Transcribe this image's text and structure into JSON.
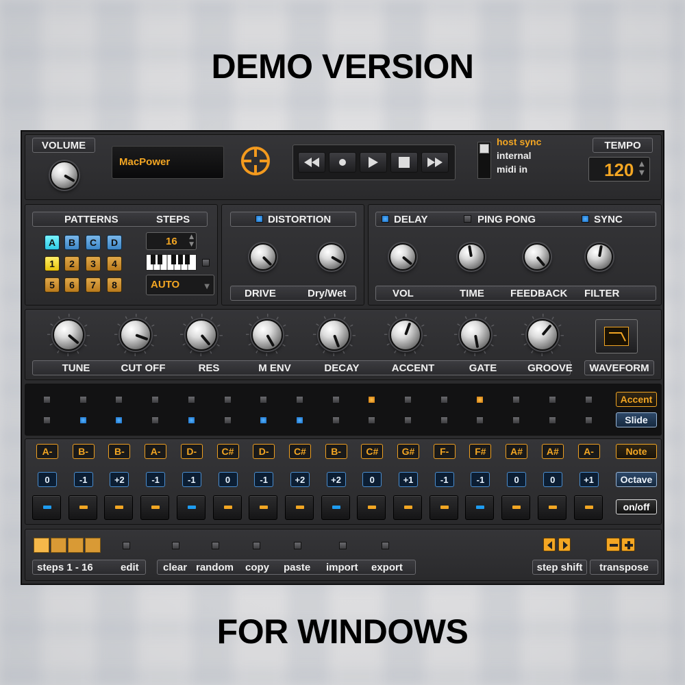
{
  "banner": {
    "top": "DEMO VERSION",
    "bottom": "FOR WINDOWS"
  },
  "header": {
    "volume_label": "VOLUME",
    "preset_name": "MacPower",
    "transport": [
      "rewind-icon",
      "record-icon",
      "play-icon",
      "stop-icon",
      "fast-forward-icon"
    ],
    "sync_options": [
      "host sync",
      "internal",
      "midi in"
    ],
    "sync_selected": "host sync",
    "tempo_label": "TEMPO",
    "tempo_value": "120"
  },
  "patterns": {
    "patterns_label": "PATTERNS",
    "steps_label": "STEPS",
    "letters": [
      "A",
      "B",
      "C",
      "D"
    ],
    "active_letter": "A",
    "numbers": [
      "1",
      "2",
      "3",
      "4",
      "5",
      "6",
      "7",
      "8"
    ],
    "active_number": "1",
    "steps_value": "16",
    "mode_value": "AUTO"
  },
  "distortion": {
    "label": "DISTORTION",
    "enabled": true,
    "drive_label": "DRIVE",
    "drywet_label": "Dry/Wet"
  },
  "delay": {
    "delay_label": "DELAY",
    "delay_enabled": true,
    "pingpong_label": "PING PONG",
    "pingpong_enabled": false,
    "sync_label": "SYNC",
    "sync_enabled": true,
    "knobs": [
      "VOL",
      "TIME",
      "FEEDBACK",
      "FILTER"
    ]
  },
  "synth_knobs": [
    "TUNE",
    "CUT OFF",
    "RES",
    "M ENV",
    "DECAY",
    "ACCENT",
    "GATE",
    "GROOVE"
  ],
  "waveform_label": "WAVEFORM",
  "sequencer": {
    "accent_label": "Accent",
    "slide_label": "Slide",
    "note_label": "Note",
    "octave_label": "Octave",
    "onoff_label": "on/off",
    "accent": [
      0,
      0,
      0,
      0,
      0,
      0,
      0,
      0,
      0,
      1,
      0,
      0,
      1,
      0,
      0,
      0
    ],
    "slide": [
      0,
      1,
      1,
      0,
      1,
      0,
      1,
      1,
      0,
      0,
      0,
      0,
      0,
      0,
      0,
      0
    ],
    "notes": [
      "A-",
      "B-",
      "B-",
      "A-",
      "D-",
      "C#",
      "D-",
      "C#",
      "B-",
      "C#",
      "G#",
      "F-",
      "F#",
      "A#",
      "A#",
      "A-"
    ],
    "octaves": [
      "0",
      "-1",
      "+2",
      "-1",
      "-1",
      "0",
      "-1",
      "+2",
      "+2",
      "0",
      "+1",
      "-1",
      "-1",
      "0",
      "0",
      "+1"
    ],
    "onoff": [
      "blue",
      "orange",
      "orange",
      "orange",
      "blue",
      "orange",
      "orange",
      "orange",
      "blue",
      "orange",
      "orange",
      "orange",
      "blue",
      "orange",
      "orange",
      "orange"
    ]
  },
  "footer": {
    "steps_range": "steps 1 - 16",
    "edit_label": "edit",
    "actions": [
      "clear",
      "random",
      "copy",
      "paste",
      "import",
      "export"
    ],
    "step_shift_label": "step shift",
    "transpose_label": "transpose",
    "colors": {
      "accent_orange": "#f3a623",
      "step_blue": "#1e9cf0",
      "panel": "#2b2b2d"
    }
  }
}
